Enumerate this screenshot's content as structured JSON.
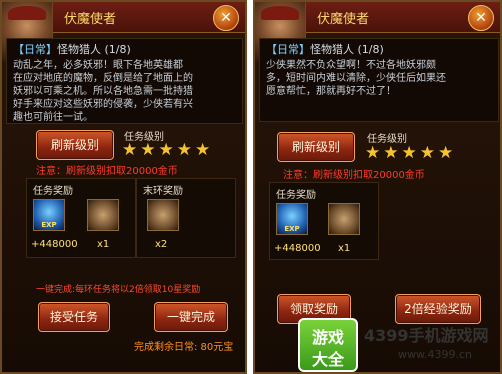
{
  "left_panel": {
    "npc_name": "伏魔使者",
    "close_icon_glyph": "✕",
    "quest_tag": "【日常】",
    "quest_name": "怪物猎人 (1/8)",
    "desc_lines": [
      "动乱之年，必多妖邪！眼下各地英雄都",
      "在应对地底的魔物，反倒是给了地面上的",
      "妖邪以可乘之机。所以各地急需一批持猎",
      "好手来应对这些妖邪的侵袭，少侠若有兴",
      "趣也可前往一试。"
    ],
    "refresh_button": "刷新级别",
    "task_level_label": "任务级别",
    "stars": 5,
    "refresh_cost_note": "注意：刷新级别扣取20000金币",
    "reward_label": "任务奖励",
    "ring_reward_label": "末环奖励",
    "exp_value": "+448000",
    "exp_icon_text": "EXP",
    "item_count": "x1",
    "ring_item_count": "x2",
    "one_key_note": "一键完成:每环任务将以2倍领取10星奖励",
    "accept_button": "接受任务",
    "one_key_button": "一键完成",
    "complete_cost_note": "完成剩余日常: 80元宝"
  },
  "right_panel": {
    "npc_name": "伏魔使者",
    "close_icon_glyph": "✕",
    "quest_tag": "【日常】",
    "quest_name": "怪物猎人 (1/8)",
    "desc_lines": [
      "少侠果然不负众望啊！不过各地妖邪颇",
      "多，短时间内难以清除，少侠任后如果还",
      "愿意帮忙，那就再好不过了！"
    ],
    "refresh_button": "刷新级别",
    "task_level_label": "任务级别",
    "stars": 5,
    "refresh_cost_note": "注意：刷新级别扣取20000金币",
    "reward_label": "任务奖励",
    "exp_value": "+448000",
    "exp_icon_text": "EXP",
    "item_count": "x1",
    "claim_button": "领取奖励",
    "double_exp_button": "2倍经验奖励"
  },
  "watermark": {
    "logo_top": "游戏",
    "logo_bottom": "大全",
    "site_name": "4399手机游戏网",
    "site_url": "www.4399.cn"
  },
  "colors": {
    "panel_bg": "#1d0f06",
    "header_red": "#6e1e12",
    "button_red": "#8c2410",
    "star_gold": "#f4c430",
    "warning_red": "#ff3b2a",
    "logo_green": "#5ab82a"
  }
}
